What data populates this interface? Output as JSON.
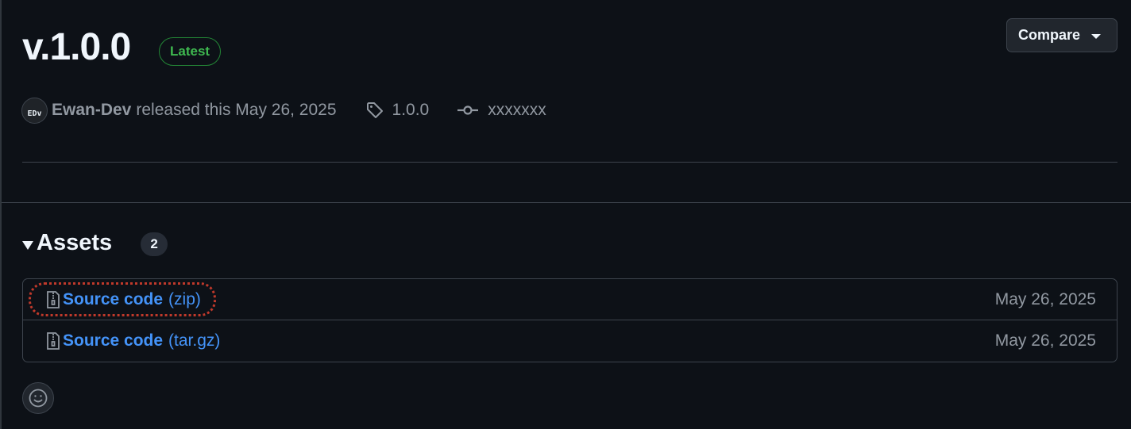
{
  "release": {
    "title": "v.1.0.0",
    "badge": "Latest",
    "compare_label": "Compare"
  },
  "meta": {
    "avatar_initials": "EDv",
    "author": "Ewan-Dev",
    "released_text": "released this May 26, 2025",
    "tag": "1.0.0",
    "commit": "xxxxxxx"
  },
  "assets": {
    "title": "Assets",
    "count": "2",
    "items": [
      {
        "name": "Source code",
        "ext": "(zip)",
        "date": "May 26, 2025"
      },
      {
        "name": "Source code",
        "ext": "(tar.gz)",
        "date": "May 26, 2025"
      }
    ]
  },
  "colors": {
    "background": "#0d1117",
    "link": "#4493f8",
    "latest_green": "#3fb950",
    "focus_ring": "#c0392b"
  },
  "icons": [
    "tag-icon",
    "commit-icon",
    "file-zip-icon",
    "smiley-icon",
    "triangle-down-icon"
  ]
}
